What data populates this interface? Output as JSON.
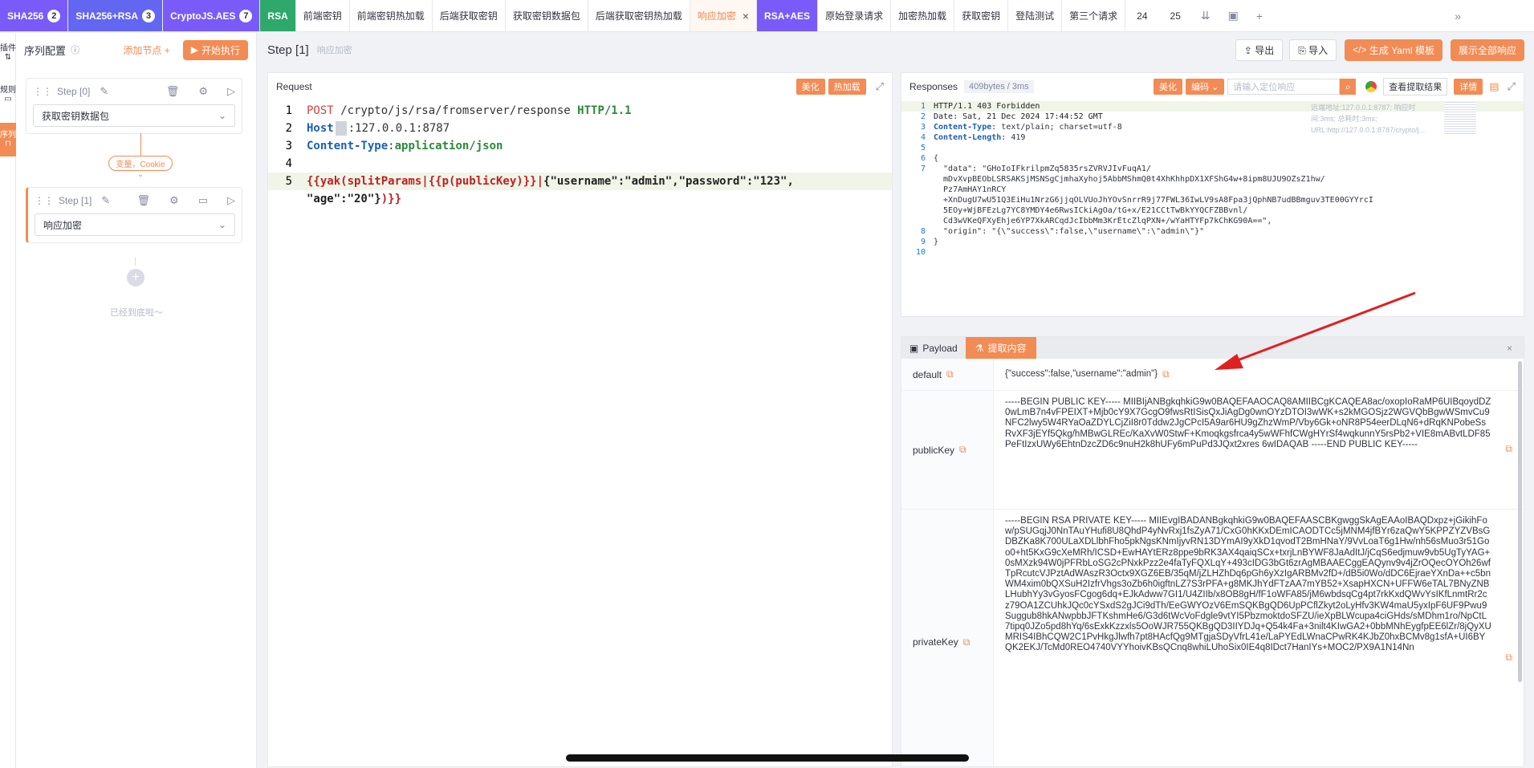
{
  "tabs": [
    {
      "label": "SHA256",
      "badge": "2",
      "bg": "#7a5af8"
    },
    {
      "label": "SHA256+RSA",
      "badge": "3",
      "bg": "#6366f1"
    },
    {
      "label": "CryptoJS.AES",
      "badge": "7",
      "bg": "#7a5af8"
    },
    {
      "label": "RSA",
      "bg": "#2ea86b"
    },
    {
      "label": "前端密钥"
    },
    {
      "label": "前端密钥热加载"
    },
    {
      "label": "后端获取密钥"
    },
    {
      "label": "获取密钥数据包"
    },
    {
      "label": "后端获取密钥热加载"
    },
    {
      "label": "响应加密",
      "active": true,
      "close": "×"
    },
    {
      "label": "RSA+AES",
      "bg": "#7a5af8"
    },
    {
      "label": "原始登录请求"
    },
    {
      "label": "加密热加载"
    },
    {
      "label": "获取密钥"
    },
    {
      "label": "登陆测试"
    },
    {
      "label": "第三个请求"
    },
    {
      "label": "24"
    },
    {
      "label": "25"
    }
  ],
  "far_left": [
    "插件",
    "规则",
    "序列"
  ],
  "left": {
    "title": "序列配置",
    "add_node": "添加节点",
    "run": "开始执行",
    "steps": [
      {
        "label": "Step [0]",
        "select": "获取密钥数据包"
      },
      {
        "label": "Step [1]",
        "select": "响应加密"
      }
    ],
    "connector": "变量，Cookie",
    "end_text": "已经到底啦～"
  },
  "header": {
    "title": "Step [1]",
    "subtitle": "响应加密",
    "export": "导出",
    "import": "导入",
    "gen_yaml": "生成 Yaml 模板",
    "show_all": "展示全部响应"
  },
  "request": {
    "title": "Request",
    "beautify": "美化",
    "hot_load": "热加载",
    "lines": [
      {
        "n": "1"
      },
      {
        "n": "2"
      },
      {
        "n": "3"
      },
      {
        "n": "4"
      },
      {
        "n": "5"
      }
    ],
    "method": "POST",
    "path": " /crypto/js/rsa/fromserver/response ",
    "proto": "HTTP/1.1",
    "host_key": "Host",
    "host_val": "127.0.0.1:8787",
    "ct_key": "Content-Type",
    "ct_val": "application/json",
    "body_tpl": "{{yak(splitParams|{{p(publicKey)}}|",
    "body_json": "{\"username\":\"admin\",\"password\":\"123\",",
    "body_json2": "\"age\":\"20\"}",
    "body_end": ")}}"
  },
  "response": {
    "title": "Responses",
    "meta": "409bytes / 3ms",
    "beautify": "美化",
    "encode": "编码",
    "search_placeholder": "请输入定位响应",
    "extract_result": "查看提取结果",
    "details": "详情",
    "remote_info": "远端地址:127.0.0.1:8787; 响应时间:3ms; 总耗时:3ms; URL:http://127.0.0.1:8787/crypto/j...",
    "lines": [
      {
        "n": "1",
        "t": "HTTP/1.1 403 Forbidden"
      },
      {
        "n": "2",
        "t": "Date: Sat, 21 Dec 2024 17:44:52 GMT"
      },
      {
        "n": "3",
        "k": "Content-Type",
        "t": " text/plain; charset=utf-8"
      },
      {
        "n": "4",
        "k": "Content-Length",
        "t": " 419"
      },
      {
        "n": "5",
        "t": ""
      },
      {
        "n": "6",
        "t": "{"
      },
      {
        "n": "7",
        "t": "  \"data\": \"GHoIoIFkrilpmZq5835rsZVRVJIvFuqA1/"
      },
      {
        "n": "",
        "t": "  mDvXvpBEObLSRSAKSjMSNSgCjmhaXyhoj5AbbMShmQ0t4XhKhhpDX1XFShG4w+8ipm8UJU9OZsZ1hw/"
      },
      {
        "n": "",
        "t": "  Pz7AmHAY1nRCY"
      },
      {
        "n": "",
        "t": "  +XnDugU7wU51Q3EiHu1NrzG6jjqOLVUoJhYOvSnrrR9j77FWL36IwLV9sA8Fpa3jQphNB7udBBmguv3TE00GYYrcI"
      },
      {
        "n": "",
        "t": "  5EOy+WjBFEzLg7YC8YMDY4e6RwsICkiAgOa/tG+x/E21CCtTwBkYYQCFZBBvnl/"
      },
      {
        "n": "",
        "t": "  Cd3wVKeQFXyEhje6YP7XkARCqdJcIbbMm3KrEtcZlqPXN+/wYaHTYFp7kChKG90A==\","
      },
      {
        "n": "8",
        "t": "  \"origin\": \"{\\\"success\\\":false,\\\"username\\\":\\\"admin\\\"}\""
      },
      {
        "n": "9",
        "t": "}"
      },
      {
        "n": "10",
        "t": ""
      }
    ]
  },
  "extract": {
    "tab_payload": "Payload",
    "tab_extract": "提取内容",
    "rows": [
      {
        "key": "default",
        "val": "{\"success\":false,\"username\":\"admin\"}"
      },
      {
        "key": "publicKey",
        "val": "-----BEGIN PUBLIC KEY----- MIIBIjANBgkqhkiG9w0BAQEFAAOCAQ8AMIIBCgKCAQEA8ac/oxopIoRaMP6UIBqoydDZ0wLmB7n4vFPEIXT+Mjb0cY9X7GcgO9fwsRtISisQxJiAgDg0wnOYzDTOI3wWK+s2kMGOSjz2WGVQbBgwWSmvCu9NFC2lwy5W4RYaOaZDYLCjZiI8r0Tddw2JgCPcI5A9ar6HU9gZhzWmP/Vby6Gk+oNR8P54eerDLqN6+dRqKNPobeSsRvXF3jEYf5Qkg/hMBwGLREc/KaXvW0StwF+Kmoqkgsfrca4y5wWFhfCWgHYrSf4wqkunnY5rsPb2+VIE8mABvtLDF85PeFtIzxUWy6EhtnDzcZD6c9nuH2k8hUFy6mPuPd3JQxt2xres 6wIDAQAB -----END PUBLIC KEY-----"
      },
      {
        "key": "privateKey",
        "val": "-----BEGIN RSA PRIVATE KEY----- MIIEvgIBADANBgkqhkiG9w0BAQEFAASCBKgwggSkAgEAAoIBAQDxpz+jGikihFow/pSUGqjJ0NnTAuYHufi8U8QhdP4yNvRxj1fsZyA71/CxG0hKKxDEmICAODTCc5jMNM4jfBYr6zaQwY5KPPZYZVBsGDBZKa8K700ULaXDLlbhFho5pkNgsKNmIjyvRN13DYmAI9yXkD1qvodT2BmHNaY/9VvLoaT6g1Hw/nh56sMuo3r51Goo0+ht5KxG9cXeMRh/ICSD+EwHAYtERz8ppe9bRK3AX4qaiqSCx+txrjLnBYWF8JaAdItJ/jCqS6edjmuw9vb5UgTyYAG+0sMXzk94W0jPFRbLoSG2cPNxkPzz2e4faTyFQXLqY+493cIDG3bGt6zrAgMBAAECggEAQynv9v4jZrOQecOYOh26wfTpRcutcVJPztAdWAszR3Octx9XGZ6EB/35qM/jZLHZhDq6pGh6yXzIgARBMv2fD+/dB5i0Wo/dDC6EjraeYXnDa++c5bnWM4xim0bQXSuH2IzfrVhgs3oZb6h0igftnLZ7S3rPFA+g8MKJhYdFTzAA7mYB52+XsapHXCN+UFFW6eTAL7BNyZNBLHubhYy3vGyosFCgog6dq+EJkAdww7GI1/U4ZIIb/x8OB8gH/fF1oWFA85/jM6wbdsqCg4pt7rkKxdQWvYsIKfLnmtRr2cz79OA1ZCUhkJQc0cYSxdS2gJCi9dTh/EeGWYOzV6EmSQKBgQD6UpPCflZkyt2oLyHfv3KW4maU5yxIpF6UF9Pwu9Suggub8hkANwpbbJFTKshmHe6/G3d6tWcVoFdgle9vtYI5PbzmoktdoSFZU/ieXpBLWcupa4ciGHds/sMDhm1ro/NpCtL7tipq0JZo5pd8hYq/6sExkKzzxls5OoWJR755QKBgQD3IIYDJq+Q54k4Fa+3nilt4KIwGA2+0bbMNhEygfpEE6lZr/8jQyXUMRIS4IBhCQW2C1PvHkgJlwfh7pt8HAcfQg9MTgjaSDyVfrL41e/LaPYEdLWnaCPwRK4KJbZ0hxBCMv8g1sfA+UI6BYQK2EKJ/TcMd0REO4740VYYhoivKBsQCnq8whiLUhoSix0IE4q8IDct7HanIYs+MOC2/PX9A1N14Nn"
      }
    ]
  }
}
